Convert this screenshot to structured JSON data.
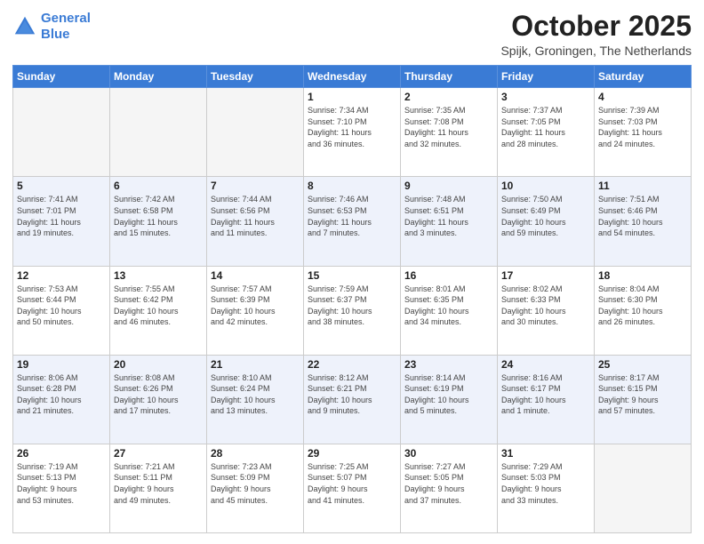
{
  "header": {
    "logo_line1": "General",
    "logo_line2": "Blue",
    "title": "October 2025",
    "location": "Spijk, Groningen, The Netherlands"
  },
  "weekdays": [
    "Sunday",
    "Monday",
    "Tuesday",
    "Wednesday",
    "Thursday",
    "Friday",
    "Saturday"
  ],
  "weeks": [
    [
      {
        "day": "",
        "info": ""
      },
      {
        "day": "",
        "info": ""
      },
      {
        "day": "",
        "info": ""
      },
      {
        "day": "1",
        "info": "Sunrise: 7:34 AM\nSunset: 7:10 PM\nDaylight: 11 hours\nand 36 minutes."
      },
      {
        "day": "2",
        "info": "Sunrise: 7:35 AM\nSunset: 7:08 PM\nDaylight: 11 hours\nand 32 minutes."
      },
      {
        "day": "3",
        "info": "Sunrise: 7:37 AM\nSunset: 7:05 PM\nDaylight: 11 hours\nand 28 minutes."
      },
      {
        "day": "4",
        "info": "Sunrise: 7:39 AM\nSunset: 7:03 PM\nDaylight: 11 hours\nand 24 minutes."
      }
    ],
    [
      {
        "day": "5",
        "info": "Sunrise: 7:41 AM\nSunset: 7:01 PM\nDaylight: 11 hours\nand 19 minutes."
      },
      {
        "day": "6",
        "info": "Sunrise: 7:42 AM\nSunset: 6:58 PM\nDaylight: 11 hours\nand 15 minutes."
      },
      {
        "day": "7",
        "info": "Sunrise: 7:44 AM\nSunset: 6:56 PM\nDaylight: 11 hours\nand 11 minutes."
      },
      {
        "day": "8",
        "info": "Sunrise: 7:46 AM\nSunset: 6:53 PM\nDaylight: 11 hours\nand 7 minutes."
      },
      {
        "day": "9",
        "info": "Sunrise: 7:48 AM\nSunset: 6:51 PM\nDaylight: 11 hours\nand 3 minutes."
      },
      {
        "day": "10",
        "info": "Sunrise: 7:50 AM\nSunset: 6:49 PM\nDaylight: 10 hours\nand 59 minutes."
      },
      {
        "day": "11",
        "info": "Sunrise: 7:51 AM\nSunset: 6:46 PM\nDaylight: 10 hours\nand 54 minutes."
      }
    ],
    [
      {
        "day": "12",
        "info": "Sunrise: 7:53 AM\nSunset: 6:44 PM\nDaylight: 10 hours\nand 50 minutes."
      },
      {
        "day": "13",
        "info": "Sunrise: 7:55 AM\nSunset: 6:42 PM\nDaylight: 10 hours\nand 46 minutes."
      },
      {
        "day": "14",
        "info": "Sunrise: 7:57 AM\nSunset: 6:39 PM\nDaylight: 10 hours\nand 42 minutes."
      },
      {
        "day": "15",
        "info": "Sunrise: 7:59 AM\nSunset: 6:37 PM\nDaylight: 10 hours\nand 38 minutes."
      },
      {
        "day": "16",
        "info": "Sunrise: 8:01 AM\nSunset: 6:35 PM\nDaylight: 10 hours\nand 34 minutes."
      },
      {
        "day": "17",
        "info": "Sunrise: 8:02 AM\nSunset: 6:33 PM\nDaylight: 10 hours\nand 30 minutes."
      },
      {
        "day": "18",
        "info": "Sunrise: 8:04 AM\nSunset: 6:30 PM\nDaylight: 10 hours\nand 26 minutes."
      }
    ],
    [
      {
        "day": "19",
        "info": "Sunrise: 8:06 AM\nSunset: 6:28 PM\nDaylight: 10 hours\nand 21 minutes."
      },
      {
        "day": "20",
        "info": "Sunrise: 8:08 AM\nSunset: 6:26 PM\nDaylight: 10 hours\nand 17 minutes."
      },
      {
        "day": "21",
        "info": "Sunrise: 8:10 AM\nSunset: 6:24 PM\nDaylight: 10 hours\nand 13 minutes."
      },
      {
        "day": "22",
        "info": "Sunrise: 8:12 AM\nSunset: 6:21 PM\nDaylight: 10 hours\nand 9 minutes."
      },
      {
        "day": "23",
        "info": "Sunrise: 8:14 AM\nSunset: 6:19 PM\nDaylight: 10 hours\nand 5 minutes."
      },
      {
        "day": "24",
        "info": "Sunrise: 8:16 AM\nSunset: 6:17 PM\nDaylight: 10 hours\nand 1 minute."
      },
      {
        "day": "25",
        "info": "Sunrise: 8:17 AM\nSunset: 6:15 PM\nDaylight: 9 hours\nand 57 minutes."
      }
    ],
    [
      {
        "day": "26",
        "info": "Sunrise: 7:19 AM\nSunset: 5:13 PM\nDaylight: 9 hours\nand 53 minutes."
      },
      {
        "day": "27",
        "info": "Sunrise: 7:21 AM\nSunset: 5:11 PM\nDaylight: 9 hours\nand 49 minutes."
      },
      {
        "day": "28",
        "info": "Sunrise: 7:23 AM\nSunset: 5:09 PM\nDaylight: 9 hours\nand 45 minutes."
      },
      {
        "day": "29",
        "info": "Sunrise: 7:25 AM\nSunset: 5:07 PM\nDaylight: 9 hours\nand 41 minutes."
      },
      {
        "day": "30",
        "info": "Sunrise: 7:27 AM\nSunset: 5:05 PM\nDaylight: 9 hours\nand 37 minutes."
      },
      {
        "day": "31",
        "info": "Sunrise: 7:29 AM\nSunset: 5:03 PM\nDaylight: 9 hours\nand 33 minutes."
      },
      {
        "day": "",
        "info": ""
      }
    ]
  ]
}
